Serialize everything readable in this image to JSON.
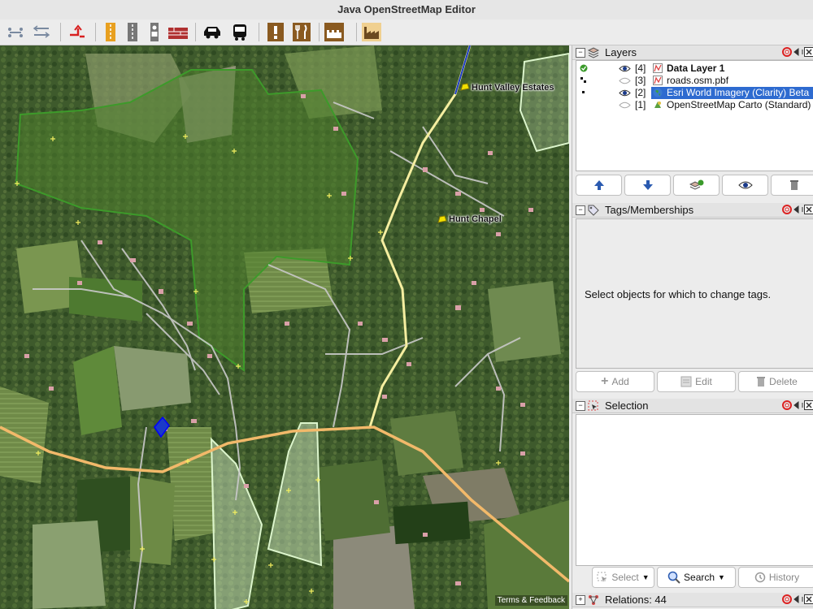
{
  "window": {
    "title": "Java OpenStreetMap Editor"
  },
  "toolbar": {
    "groups": [
      {
        "icons": [
          "select-node-icon",
          "align-icon"
        ]
      },
      {
        "icons": [
          "split-way-icon"
        ]
      },
      {
        "icons": [
          "highway-preset-icon",
          "railway-preset-icon",
          "traffic-signal-preset-icon",
          "barrier-preset-icon"
        ]
      },
      {
        "icons": [
          "car-preset-icon",
          "bus-preset-icon"
        ]
      },
      {
        "icons": [
          "emergency-preset-icon",
          "restaurant-preset-icon"
        ]
      },
      {
        "icons": [
          "historic-preset-icon"
        ]
      },
      {
        "icons": [
          "industrial-preset-icon"
        ]
      }
    ]
  },
  "map": {
    "labels": [
      {
        "text": "Hunt Valley Estates"
      },
      {
        "text": "Hunt Chapel"
      }
    ],
    "attribution": "Terms & Feedback",
    "colors": {
      "forest_area": "#3d9a2a",
      "farmland": "#dcf5cc",
      "road_primary": "#f2b96a",
      "road_secondary": "#f5eea0",
      "road_residential": "#c9c9c9"
    }
  },
  "layers_panel": {
    "title": "Layers",
    "layers": [
      {
        "index": "[4]",
        "name": "Data Layer 1",
        "visible": true,
        "active": true,
        "bold": true,
        "icon": "data-layer-icon"
      },
      {
        "index": "[3]",
        "name": "roads.osm.pbf",
        "visible": false,
        "bold": false,
        "icon": "data-layer-icon"
      },
      {
        "index": "[2]",
        "name": "Esri World Imagery (Clarity) Beta",
        "visible": true,
        "selected": true,
        "icon": "globe-icon"
      },
      {
        "index": "[1]",
        "name": "OpenStreetMap Carto (Standard)",
        "visible": false,
        "icon": "imagery-icon"
      }
    ],
    "buttons": [
      "move-up-icon",
      "move-down-icon",
      "activate-layer-icon",
      "toggle-visibility-icon",
      "delete-layer-icon"
    ]
  },
  "tags_panel": {
    "title": "Tags/Memberships",
    "empty_message": "Select objects for which to change tags.",
    "add_label": "Add",
    "edit_label": "Edit",
    "delete_label": "Delete"
  },
  "selection_panel": {
    "title": "Selection",
    "select_label": "Select",
    "search_label": "Search",
    "history_label": "History"
  },
  "relations_panel": {
    "title": "Relations: 44"
  }
}
